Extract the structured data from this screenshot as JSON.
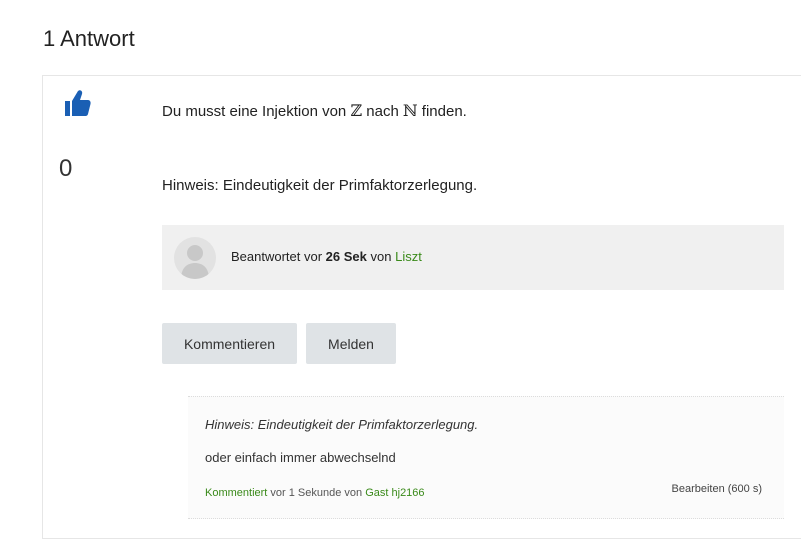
{
  "answers_heading": "1 Antwort",
  "vote": {
    "icon": "thumbs-up-icon",
    "count": "0"
  },
  "answer": {
    "line1_prefix": "Du musst eine Injektion von",
    "math_from": "ℤ",
    "line1_mid": "nach",
    "math_to": "ℕ",
    "line1_suffix": "finden.",
    "line2": "Hinweis: Eindeutigkeit der Primfaktorzerlegung."
  },
  "meta": {
    "answered_prefix": "Beantwortet vor",
    "time": "26 Sek",
    "by": "von",
    "author": "Liszt"
  },
  "buttons": {
    "comment": "Kommentieren",
    "report": "Melden"
  },
  "comment": {
    "quote": "Hinweis: Eindeutigkeit der Primfaktorzerlegung.",
    "text": "oder einfach immer abwechselnd",
    "commented_label": "Kommentiert",
    "time_text": "vor 1 Sekunde von",
    "author": "Gast hj2166",
    "edit_label": "Bearbeiten (600 s)"
  },
  "colors": {
    "accent_green": "#3a8a1a",
    "vote_blue": "#1a5fb4"
  }
}
